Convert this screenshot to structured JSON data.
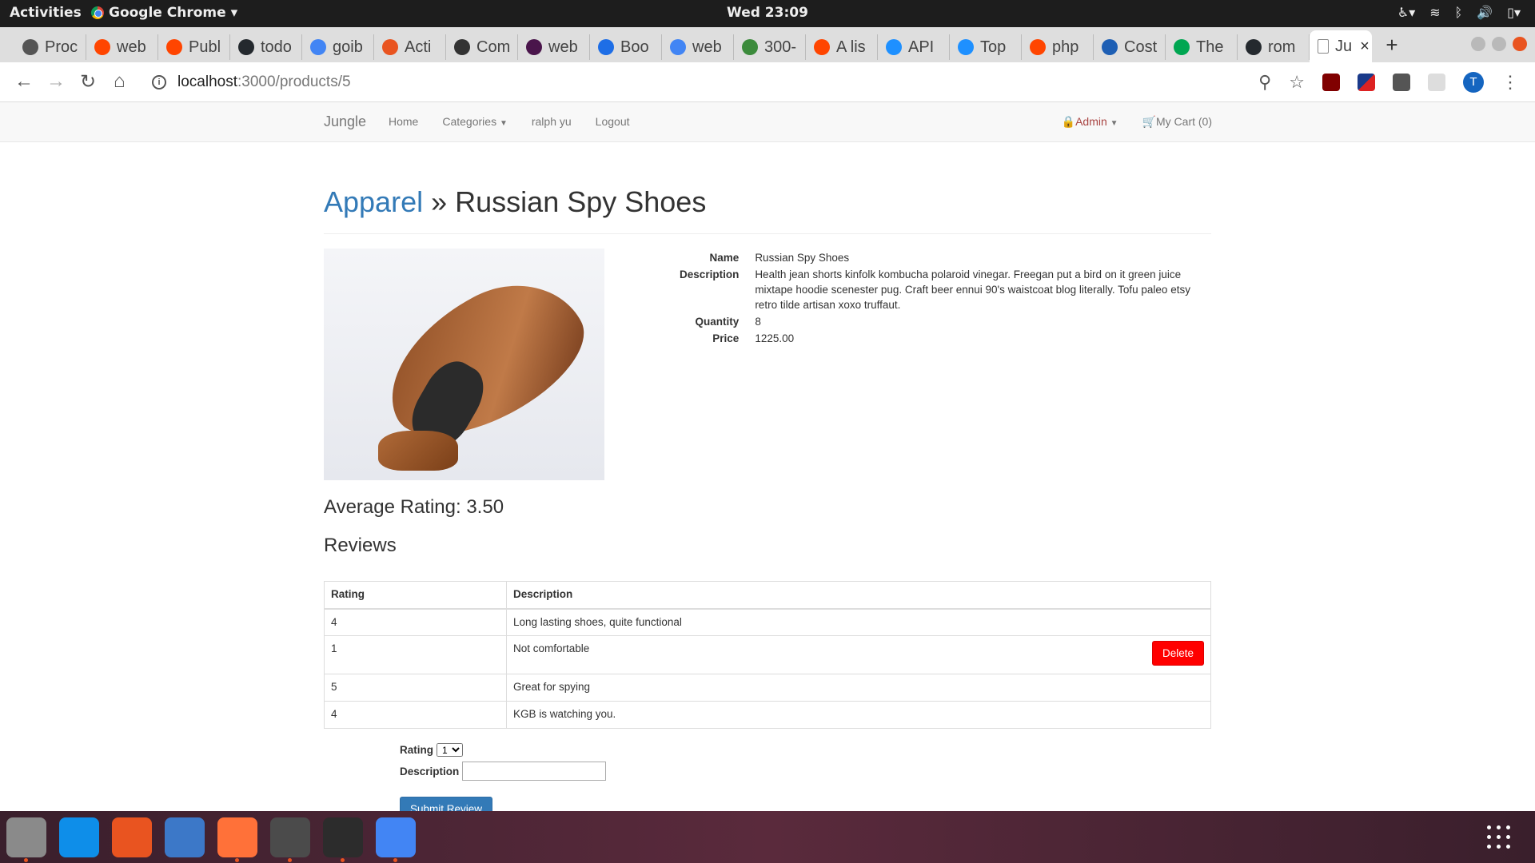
{
  "os": {
    "activities": "Activities",
    "app_name": "Google Chrome",
    "clock": "Wed 23:09"
  },
  "tabs": [
    {
      "label": "Proc",
      "color": "#555555"
    },
    {
      "label": "web",
      "color": "#ff4500"
    },
    {
      "label": "Publ",
      "color": "#ff4500"
    },
    {
      "label": "todo",
      "color": "#24292e"
    },
    {
      "label": "goib",
      "color": "#4285f4"
    },
    {
      "label": "Acti",
      "color": "#e95420"
    },
    {
      "label": "Com",
      "color": "#333333"
    },
    {
      "label": "web",
      "color": "#4a154b"
    },
    {
      "label": "Boo",
      "color": "#1e6ee6"
    },
    {
      "label": "web",
      "color": "#4285f4"
    },
    {
      "label": "300-",
      "color": "#3c8b3c"
    },
    {
      "label": "A lis",
      "color": "#ff4500"
    },
    {
      "label": "API",
      "color": "#1e90ff"
    },
    {
      "label": "Top",
      "color": "#1e90ff"
    },
    {
      "label": "php",
      "color": "#ff4500"
    },
    {
      "label": "Cost",
      "color": "#1e5fb4"
    },
    {
      "label": "The",
      "color": "#00a651"
    },
    {
      "label": "rom",
      "color": "#24292e"
    }
  ],
  "active_tab": {
    "label": "Ju",
    "close": "×"
  },
  "new_tab": "+",
  "omnibox": {
    "host": "localhost",
    "path": ":3000/products/5"
  },
  "navbar": {
    "brand": "Jungle",
    "links": [
      "Home",
      "Categories",
      "ralph yu",
      "Logout"
    ],
    "admin": "Admin",
    "cart": "My Cart (0)"
  },
  "product": {
    "category": "Apparel",
    "separator": "»",
    "name_heading": "Russian Spy Shoes",
    "fields": [
      {
        "label": "Name",
        "value": "Russian Spy Shoes"
      },
      {
        "label": "Description",
        "value": "Health jean shorts kinfolk kombucha polaroid vinegar. Freegan put a bird on it green juice mixtape hoodie scenester pug. Craft beer ennui 90's waistcoat blog literally. Tofu paleo etsy retro tilde artisan xoxo truffaut."
      },
      {
        "label": "Quantity",
        "value": "8"
      },
      {
        "label": "Price",
        "value": "1225.00"
      }
    ]
  },
  "average_rating": "Average Rating: 3.50",
  "reviews_heading": "Reviews",
  "reviews_table": {
    "headers": [
      "Rating",
      "Description"
    ],
    "rows": [
      {
        "rating": "4",
        "description": "Long lasting shoes, quite functional",
        "delete": ""
      },
      {
        "rating": "1",
        "description": "Not comfortable",
        "delete": "Delete"
      },
      {
        "rating": "5",
        "description": "Great for spying",
        "delete": ""
      },
      {
        "rating": "4",
        "description": "KGB is watching you.",
        "delete": ""
      }
    ]
  },
  "review_form": {
    "rating_label": "Rating",
    "rating_selected": "1",
    "description_label": "Description",
    "description_value": "",
    "submit_label": "Submit Review"
  },
  "dock": [
    {
      "name": "files-icon",
      "color": "#8a8a8a"
    },
    {
      "name": "teamviewer-icon",
      "color": "#0e8ee9"
    },
    {
      "name": "software-center-icon",
      "color": "#e95420"
    },
    {
      "name": "help-icon",
      "color": "#3c78c8"
    },
    {
      "name": "firefox-icon",
      "color": "#ff7139"
    },
    {
      "name": "sublime-text-icon",
      "color": "#4b4b4b"
    },
    {
      "name": "terminal-icon",
      "color": "#2c2c2c"
    },
    {
      "name": "chrome-icon",
      "color": "#4285f4"
    }
  ]
}
